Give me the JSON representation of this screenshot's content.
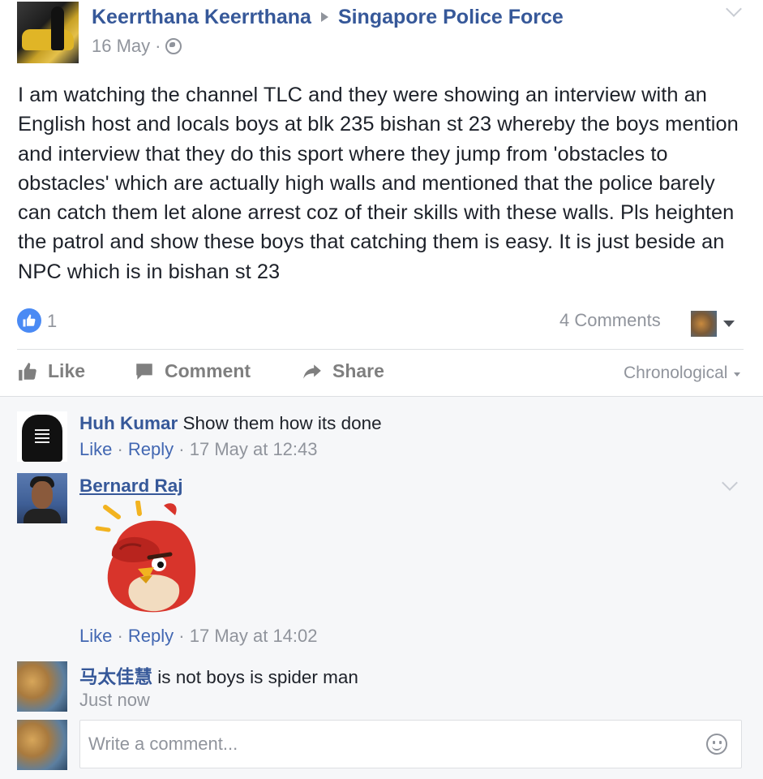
{
  "post": {
    "author": "Keerrthana Keerrthana",
    "target_page": "Singapore Police Force",
    "date": "16 May",
    "separator": "·",
    "text": "I am watching the channel TLC and they were showing an interview with an English host and locals boys at blk 235 bishan st 23 whereby the boys mention and interview that they do this sport where they jump from 'obstacles to obstacles' which are actually high walls and mentioned that the police barely can catch them let alone arrest coz of their skills with these walls. Pls heighten the patrol and show these boys that catching them is easy. It is just beside an NPC which is in bishan st 23",
    "like_count": "1",
    "comments_count": "4 Comments"
  },
  "actions": {
    "like": "Like",
    "comment": "Comment",
    "share": "Share",
    "sort": "Chronological"
  },
  "comments": [
    {
      "name": "Huh Kumar",
      "text": "Show them how its done",
      "like": "Like",
      "reply": "Reply",
      "time": "17 May at 12:43"
    },
    {
      "name": "Bernard Raj",
      "like": "Like",
      "reply": "Reply",
      "time": "17 May at 14:02"
    },
    {
      "name": "马太佳慧",
      "text": "is not boys is spider man",
      "time": "Just now"
    }
  ],
  "composer": {
    "placeholder": "Write a comment..."
  },
  "colors": {
    "link": "#365899",
    "meta": "#90949c",
    "like_badge": "#4a8af4",
    "comments_bg": "#f6f7f9"
  },
  "icons": {
    "globe": "globe-icon",
    "like": "thumbs-up-icon",
    "comment": "speech-bubble-icon",
    "share": "share-arrow-icon",
    "emoji": "smiley-icon"
  }
}
